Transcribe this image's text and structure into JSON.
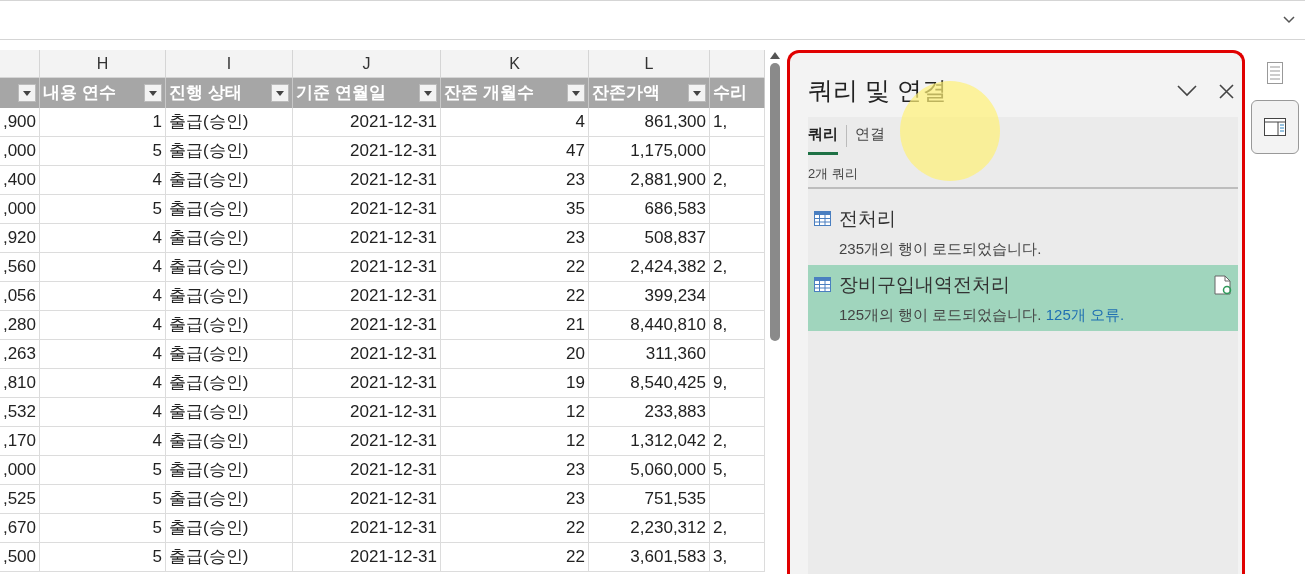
{
  "columns": [
    {
      "filter": true
    },
    {
      "letter": "H",
      "label": "내용 연수",
      "filter": true
    },
    {
      "letter": "I",
      "label": "진행 상태",
      "filter": true
    },
    {
      "letter": "J",
      "label": "기준 연월일",
      "filter": true
    },
    {
      "letter": "K",
      "label": "잔존 개월수",
      "filter": true
    },
    {
      "letter": "L",
      "label": "잔존가액",
      "filter": true
    },
    {
      "label": "수리",
      "filter": false
    }
  ],
  "rows": [
    [
      ",900",
      "1",
      "출급(승인)",
      "2021-12-31",
      "4",
      "861,300",
      "1,"
    ],
    [
      ",000",
      "5",
      "출급(승인)",
      "2021-12-31",
      "47",
      "1,175,000"
    ],
    [
      ",400",
      "4",
      "출급(승인)",
      "2021-12-31",
      "23",
      "2,881,900",
      "2,"
    ],
    [
      ",000",
      "5",
      "출급(승인)",
      "2021-12-31",
      "35",
      "686,583"
    ],
    [
      ",920",
      "4",
      "출급(승인)",
      "2021-12-31",
      "23",
      "508,837"
    ],
    [
      ",560",
      "4",
      "출급(승인)",
      "2021-12-31",
      "22",
      "2,424,382",
      "2,"
    ],
    [
      ",056",
      "4",
      "출급(승인)",
      "2021-12-31",
      "22",
      "399,234"
    ],
    [
      ",280",
      "4",
      "출급(승인)",
      "2021-12-31",
      "21",
      "8,440,810",
      "8,"
    ],
    [
      ",263",
      "4",
      "출급(승인)",
      "2021-12-31",
      "20",
      "311,360"
    ],
    [
      ",810",
      "4",
      "출급(승인)",
      "2021-12-31",
      "19",
      "8,540,425",
      "9,"
    ],
    [
      ",532",
      "4",
      "출급(승인)",
      "2021-12-31",
      "12",
      "233,883"
    ],
    [
      ",170",
      "4",
      "출급(승인)",
      "2021-12-31",
      "12",
      "1,312,042",
      "2,"
    ],
    [
      ",000",
      "5",
      "출급(승인)",
      "2021-12-31",
      "23",
      "5,060,000",
      "5,"
    ],
    [
      ",525",
      "5",
      "출급(승인)",
      "2021-12-31",
      "23",
      "751,535"
    ],
    [
      ",670",
      "5",
      "출급(승인)",
      "2021-12-31",
      "22",
      "2,230,312",
      "2,"
    ],
    [
      ",500",
      "5",
      "출급(승인)",
      "2021-12-31",
      "22",
      "3,601,583",
      "3,"
    ]
  ],
  "panel": {
    "title": "쿼리 및 연결",
    "tabs": [
      {
        "label": "쿼리",
        "selected": true
      },
      {
        "label": "연결",
        "selected": false
      }
    ],
    "count": "2개 쿼리",
    "queries": [
      {
        "name": "전처리",
        "status": "235개의 행이 로드되었습니다.",
        "selected": false
      },
      {
        "name": "장비구입내역전처리",
        "status": "125개의 행이 로드되었습니다.",
        "error": "125개 오류.",
        "selected": true
      }
    ]
  }
}
